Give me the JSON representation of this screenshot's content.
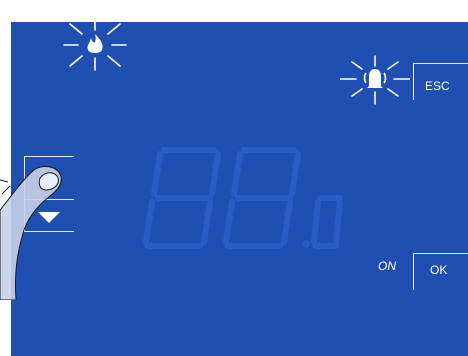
{
  "display": {
    "background_color": "#1f4fb0",
    "flame_icon": "flame-icon",
    "alarm_icon": "alarm-bell-icon"
  },
  "buttons": {
    "esc_label": "ESC",
    "ok_label": "OK",
    "up_icon": "arrow-up-icon",
    "down_icon": "arrow-down-icon"
  },
  "status": {
    "on_label": "ON"
  },
  "segment_display": {
    "value": "88.8"
  }
}
